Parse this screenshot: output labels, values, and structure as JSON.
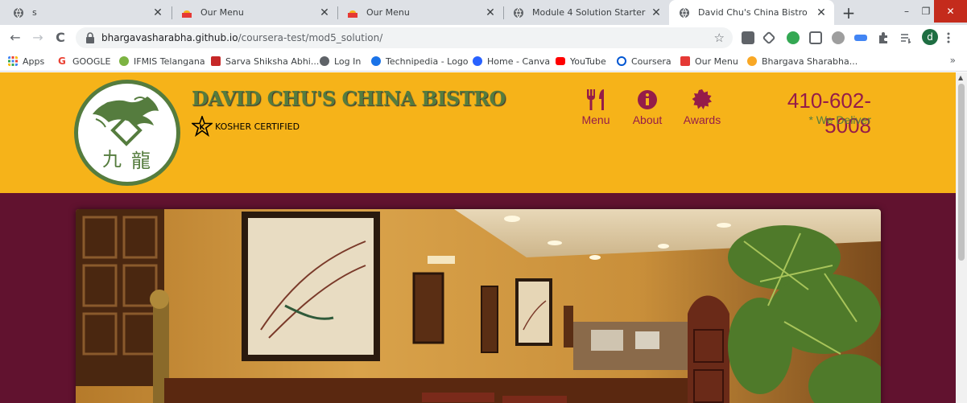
{
  "browser": {
    "tabs": [
      {
        "title": "s",
        "active": false
      },
      {
        "title": "Our Menu",
        "active": false
      },
      {
        "title": "Our Menu",
        "active": false
      },
      {
        "title": "Module 4 Solution Starter",
        "active": false
      },
      {
        "title": "David Chu's China Bistro",
        "active": true
      }
    ],
    "tab_close_glyph": "✕",
    "new_tab_glyph": "+",
    "window_controls": {
      "minimize": "–",
      "restore": "❐",
      "close": "✕"
    },
    "nav": {
      "back": "←",
      "forward": "→",
      "reload": "C"
    },
    "address": {
      "host": "bhargavasharabha.github.io",
      "path": "/coursera-test/mod5_solution/"
    },
    "star_glyph": "☆",
    "profile_initial": "d",
    "bookmarks": [
      {
        "label": "Apps",
        "color": "#4285f4"
      },
      {
        "label": "GOOGLE",
        "color": "#ea4335"
      },
      {
        "label": "IFMIS Telangana",
        "color": "#7cb342"
      },
      {
        "label": "Sarva Shiksha Abhi...",
        "color": "#c62828"
      },
      {
        "label": "Log In",
        "color": "#5f6368"
      },
      {
        "label": "Technipedia - Logo",
        "color": "#1a73e8"
      },
      {
        "label": "Home - Canva",
        "color": "#2962ff"
      },
      {
        "label": "YouTube",
        "color": "#ff0000"
      },
      {
        "label": "Coursera",
        "color": "#0056d2"
      },
      {
        "label": "Our Menu",
        "color": "#e53935"
      },
      {
        "label": "Bhargava Sharabha...",
        "color": "#f9a825"
      }
    ],
    "bookmarks_more": "»"
  },
  "site": {
    "brand_name": "DAVID CHU'S CHINA BISTRO",
    "kosher_text": "KOSHER CERTIFIED",
    "nav": [
      {
        "label": "Menu",
        "icon": "cutlery-icon"
      },
      {
        "label": "About",
        "icon": "info-icon"
      },
      {
        "label": "Awards",
        "icon": "certificate-icon"
      }
    ],
    "phone": "410-602-5008",
    "deliver": "* We Deliver",
    "colors": {
      "header_bg": "#f6b319",
      "body_bg": "#61122f",
      "brand_green": "#557c3e",
      "accent_maroon": "#951c49"
    }
  }
}
